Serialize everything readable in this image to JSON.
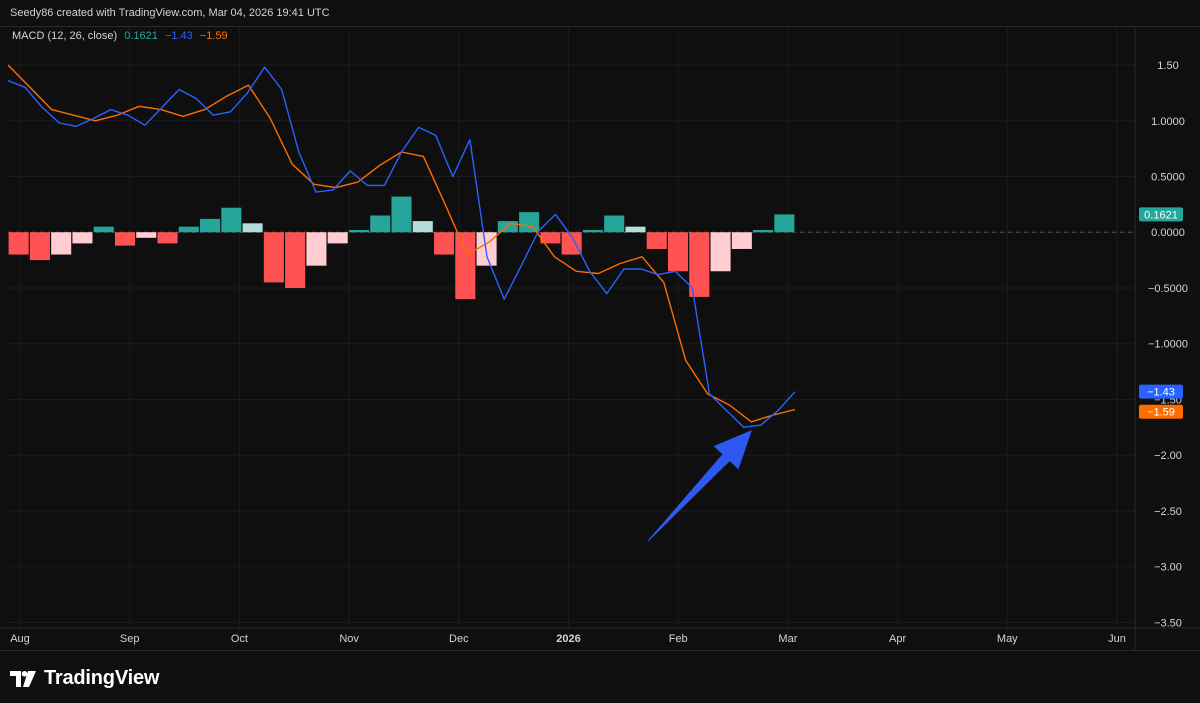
{
  "header": {
    "credit": "Seedy86 created with TradingView.com, Mar 04, 2026 19:41 UTC"
  },
  "legend": {
    "title": "MACD (12, 26, close)",
    "hist_value": "0.1621",
    "macd_value": "−1.43",
    "signal_value": "−1.59"
  },
  "footer": {
    "brand": "TradingView"
  },
  "colors": {
    "background": "#0f0f0f",
    "macd_line": "#2962ff",
    "signal_line": "#ff6d00",
    "hist_pos_strong": "#26a69a",
    "hist_pos_weak": "#b2dfdb",
    "hist_neg_strong": "#ff5252",
    "hist_neg_weak": "#ffcdd2",
    "annotation_arrow": "#2e59f0"
  },
  "chart_data": {
    "type": "line",
    "title": "MACD (12, 26, close)",
    "ylim": [
      -3.55,
      1.85
    ],
    "y_ticks": [
      "1.50",
      "1.0000",
      "0.5000",
      "0.0000",
      "−0.5000",
      "−1.0000",
      "−1.50",
      "−2.00",
      "−2.50",
      "−3.00",
      "−3.50"
    ],
    "x_tick_labels": [
      "Aug",
      "Sep",
      "Oct",
      "Nov",
      "Dec",
      "2026",
      "Feb",
      "Mar",
      "Apr",
      "May",
      "Jun"
    ],
    "last_labels": {
      "histogram": "0.1621",
      "macd": "−1.43",
      "signal": "−1.59"
    },
    "grid": true,
    "series": [
      {
        "name": "MACD",
        "values": [
          1.36,
          1.3,
          1.12,
          0.98,
          0.95,
          1.02,
          1.1,
          1.05,
          0.96,
          1.12,
          1.28,
          1.2,
          1.05,
          1.08,
          1.25,
          1.48,
          1.28,
          0.72,
          0.36,
          0.38,
          0.55,
          0.42,
          0.42,
          0.72,
          0.94,
          0.87,
          0.5,
          0.83,
          -0.22,
          -0.6,
          -0.3,
          0.01,
          0.16,
          -0.05,
          -0.35,
          -0.55,
          -0.33,
          -0.33,
          -0.38,
          -0.35,
          -0.5,
          -1.45,
          -1.6,
          -1.75,
          -1.73,
          -1.6,
          -1.43
        ]
      },
      {
        "name": "Signal",
        "values": [
          1.5,
          1.3,
          1.1,
          1.05,
          1.0,
          1.05,
          1.13,
          1.1,
          1.04,
          1.1,
          1.22,
          1.32,
          1.02,
          0.61,
          0.43,
          0.4,
          0.45,
          0.6,
          0.72,
          0.68,
          0.25,
          -0.2,
          -0.09,
          0.08,
          0.05,
          -0.22,
          -0.35,
          -0.37,
          -0.28,
          -0.22,
          -0.45,
          -1.15,
          -1.45,
          -1.55,
          -1.7,
          -1.64,
          -1.59
        ]
      },
      {
        "name": "Histogram",
        "values": [
          -0.2,
          -0.25,
          -0.2,
          -0.1,
          0.05,
          -0.12,
          -0.05,
          -0.1,
          0.05,
          0.12,
          0.22,
          0.08,
          -0.45,
          -0.5,
          -0.3,
          -0.1,
          0.02,
          0.15,
          0.32,
          0.1,
          -0.2,
          -0.6,
          -0.3,
          0.1,
          0.18,
          -0.1,
          -0.2,
          0.02,
          0.15,
          0.05,
          -0.15,
          -0.35,
          -0.58,
          -0.35,
          -0.15,
          0.02,
          0.16
        ]
      }
    ]
  }
}
